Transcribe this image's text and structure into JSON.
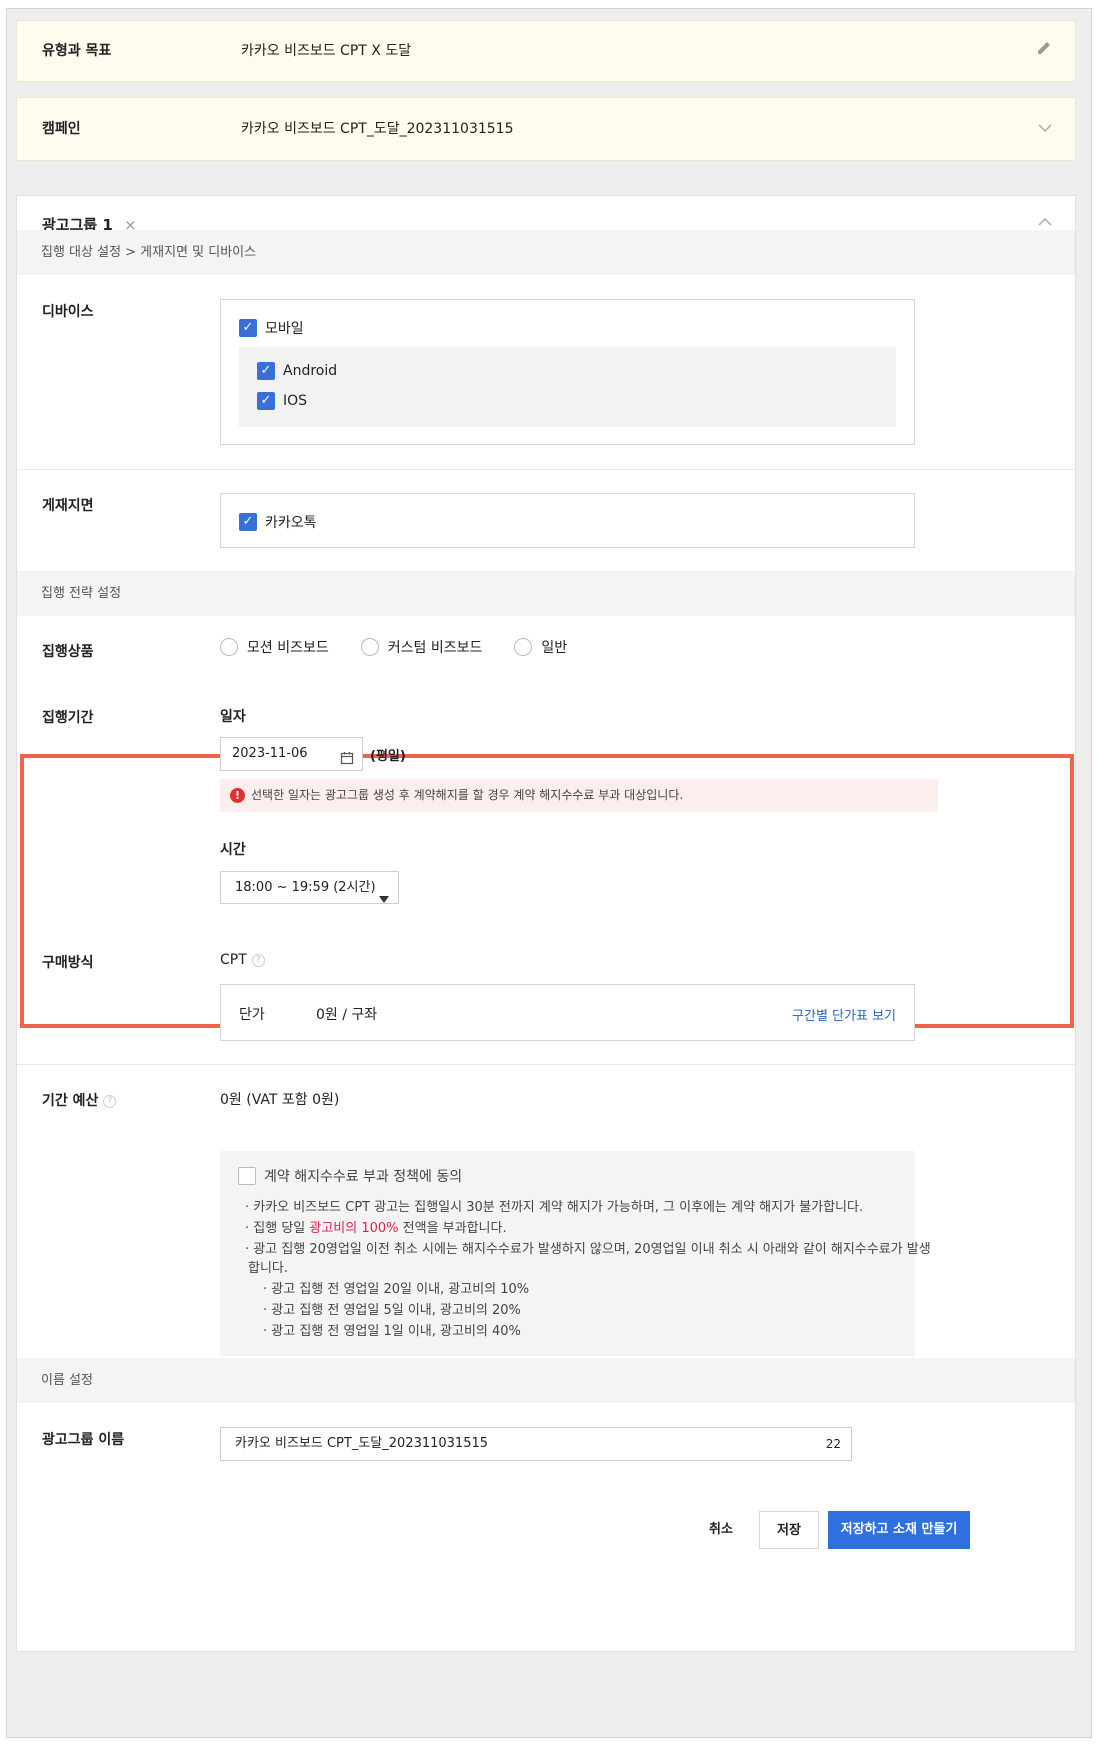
{
  "type_goal": {
    "label": "유형과 목표",
    "value": "카카오 비즈보드 CPT X 도달",
    "icon": "pencil-icon"
  },
  "campaign": {
    "label": "캠페인",
    "value": "카카오 비즈보드 CPT_도달_202311031515",
    "icon": "chevron-down-icon"
  },
  "ad_group": {
    "title": "광고그룹 1",
    "close": "×",
    "collapse": "⌃",
    "target_section": "집행 대상 설정 > 게재지면 및 디바이스",
    "device": {
      "label": "디바이스",
      "mobile": "모바일",
      "android": "Android",
      "ios": "IOS"
    },
    "placement": {
      "label": "게재지면",
      "kakaotalk": "카카오톡"
    },
    "strategy_section": "집행 전략 설정",
    "product": {
      "label": "집행상품",
      "options": [
        "모션 비즈보드",
        "커스텀 비즈보드",
        "일반"
      ]
    },
    "period": {
      "label": "집행기간",
      "date_label": "일자",
      "date_value": "2023-11-06",
      "date_suffix": "(평일)",
      "warning": "선택한 일자는 광고그룹 생성 후 계약해지를 할 경우 계약 해지수수료 부과 대상입니다.",
      "time_label": "시간",
      "time_value": "18:00 ~ 19:59 (2시간)"
    },
    "purchase": {
      "label": "구매방식",
      "value": "CPT",
      "unit_label": "단가",
      "unit_value": "0원 / 구좌",
      "price_link": "구간별 단가표 보기"
    },
    "budget": {
      "label": "기간 예산",
      "value": "0원 (VAT 포함 0원)",
      "agree": "계약 해지수수료 부과 정책에 동의",
      "line1": "· 카카오 비즈보드 CPT 광고는 집행일시 30분 전까지 계약 해지가 가능하며, 그 이후에는 계약 해지가 불가합니다.",
      "line2_a": "· 집행 당일 ",
      "line2_red": "광고비의 100%",
      "line2_b": " 전액을 부과합니다.",
      "line3": "· 광고 집행 20영업일 이전 취소 시에는 해지수수료가 발생하지 않으며, 20영업일 이내 취소 시 아래와 같이 해지수수료가 발생",
      "line3b": "합니다.",
      "sub1": "· 광고 집행 전 영업일 20일 이내, 광고비의 10%",
      "sub2": "· 광고 집행 전 영업일 5일 이내, 광고비의 20%",
      "sub3": "· 광고 집행 전 영업일 1일 이내, 광고비의 40%"
    },
    "name_section": "이름 설정",
    "name": {
      "label": "광고그룹 이름",
      "value": "카카오 비즈보드 CPT_도달_202311031515",
      "count": "22"
    }
  },
  "footer": {
    "cancel": "취소",
    "save": "저장",
    "save_create": "저장하고 소재 만들기"
  },
  "colors": {
    "accent": "#3a6fd8",
    "highlight": "#f2634d",
    "primary_button": "#2f6fe0"
  }
}
